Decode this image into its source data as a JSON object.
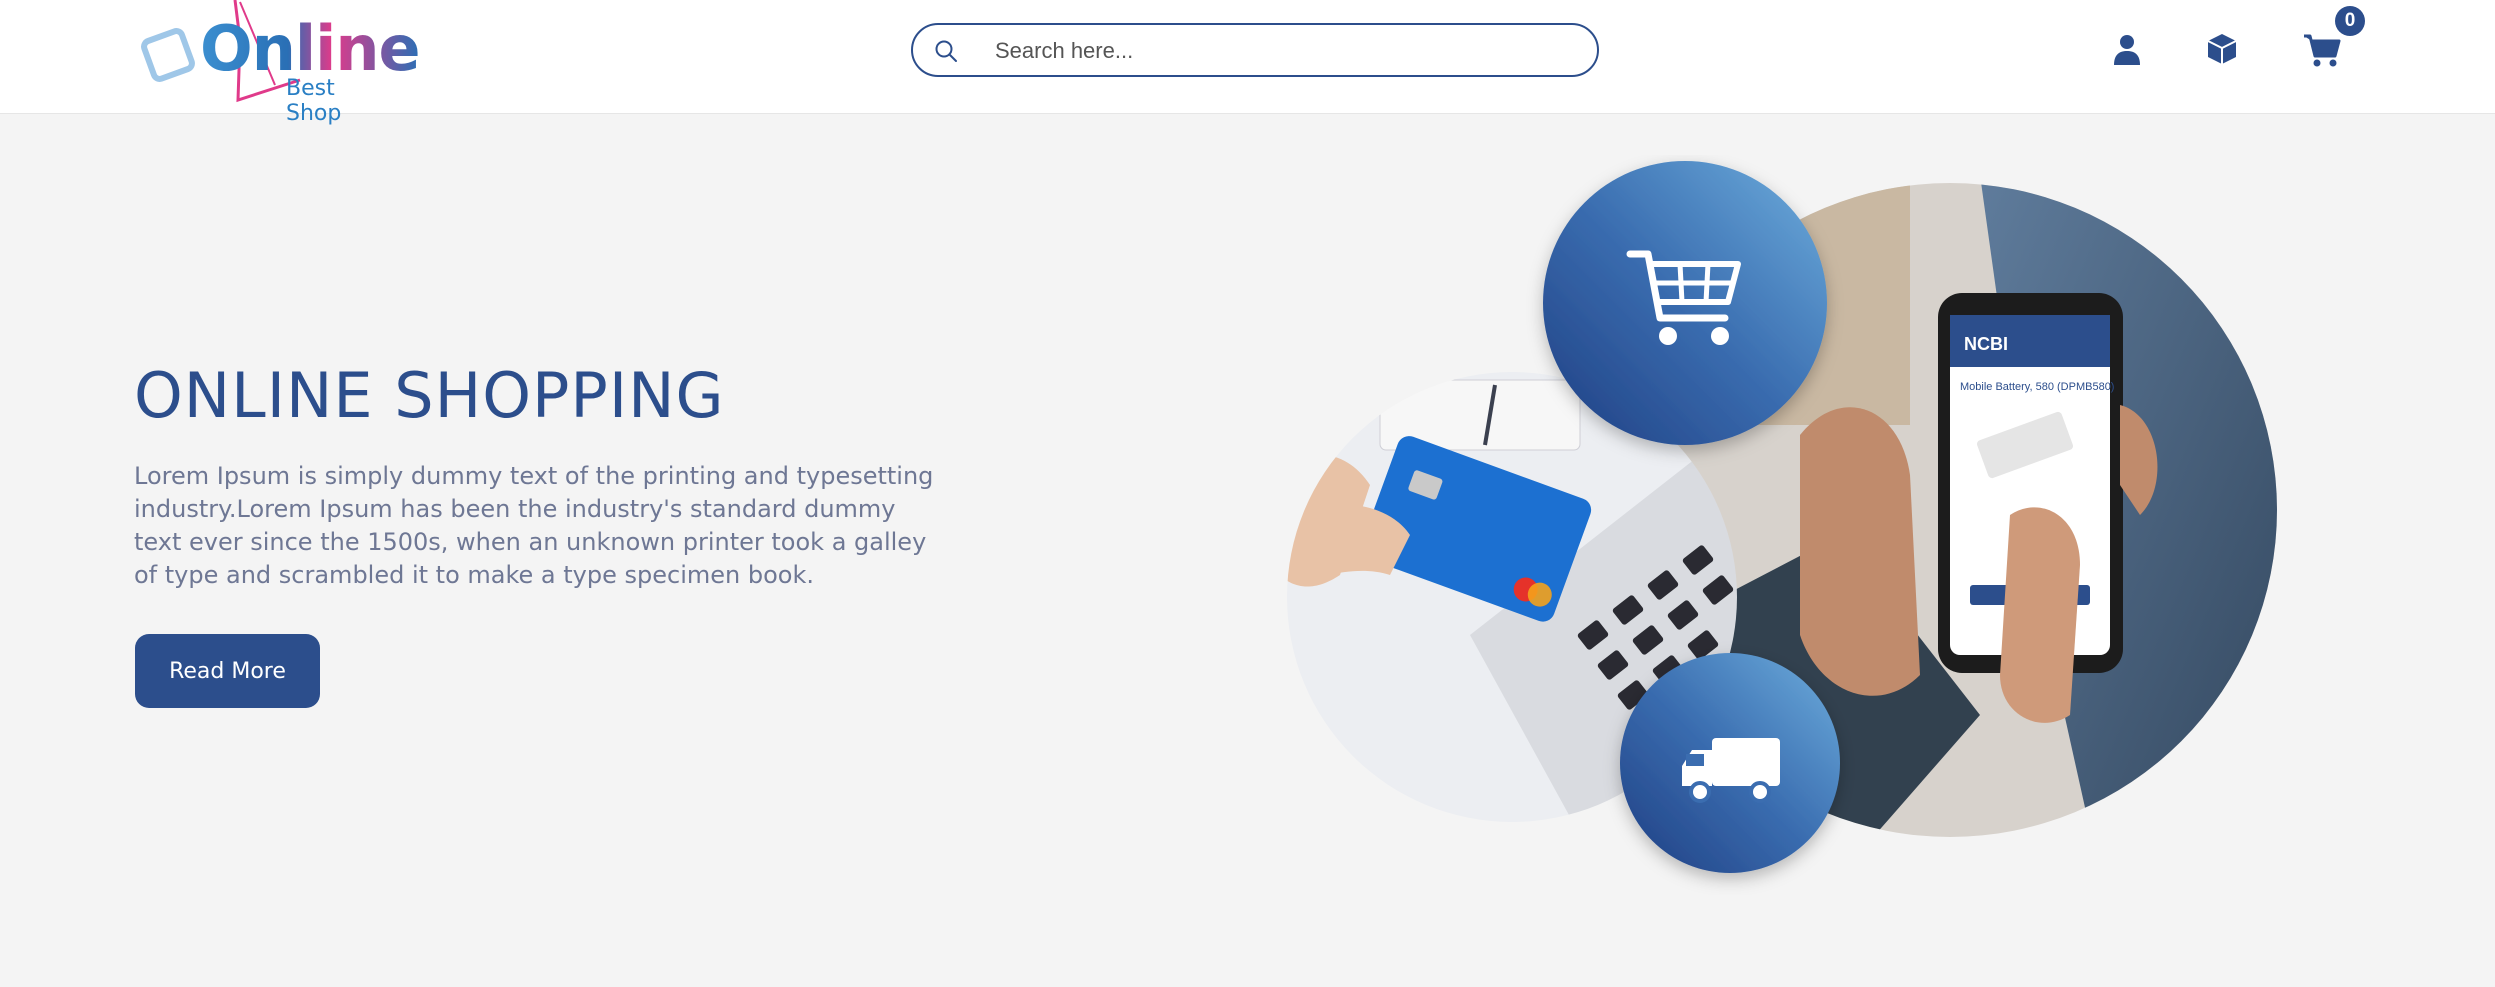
{
  "brand": {
    "logo_word": "Online",
    "logo_sub": "Best Shop"
  },
  "search": {
    "placeholder": "Search here...",
    "icon": "search-icon"
  },
  "header_actions": {
    "user_icon": "user-icon",
    "orders_icon": "box-icon",
    "cart_icon": "cart-icon",
    "cart_count": "0"
  },
  "hero": {
    "title": "ONLINE SHOPPING",
    "text": "Lorem Ipsum is simply dummy text of the printing and typesetting industry.Lorem Ipsum has been the industry's standard dummy text ever since the 1500s, when an unknown printer took a galley of type and scrambled it to make a type specimen book.",
    "button_label": "Read More"
  },
  "hero_art": {
    "phone_brand": "NCBI",
    "phone_product": "Mobile Battery, 580 (DPMB580)",
    "icons": [
      "shopping-cart-icon",
      "delivery-truck-icon"
    ]
  },
  "colors": {
    "brand_blue": "#2c4e8c",
    "page_bg": "#f4f4f4",
    "text_muted": "#6e7794"
  }
}
